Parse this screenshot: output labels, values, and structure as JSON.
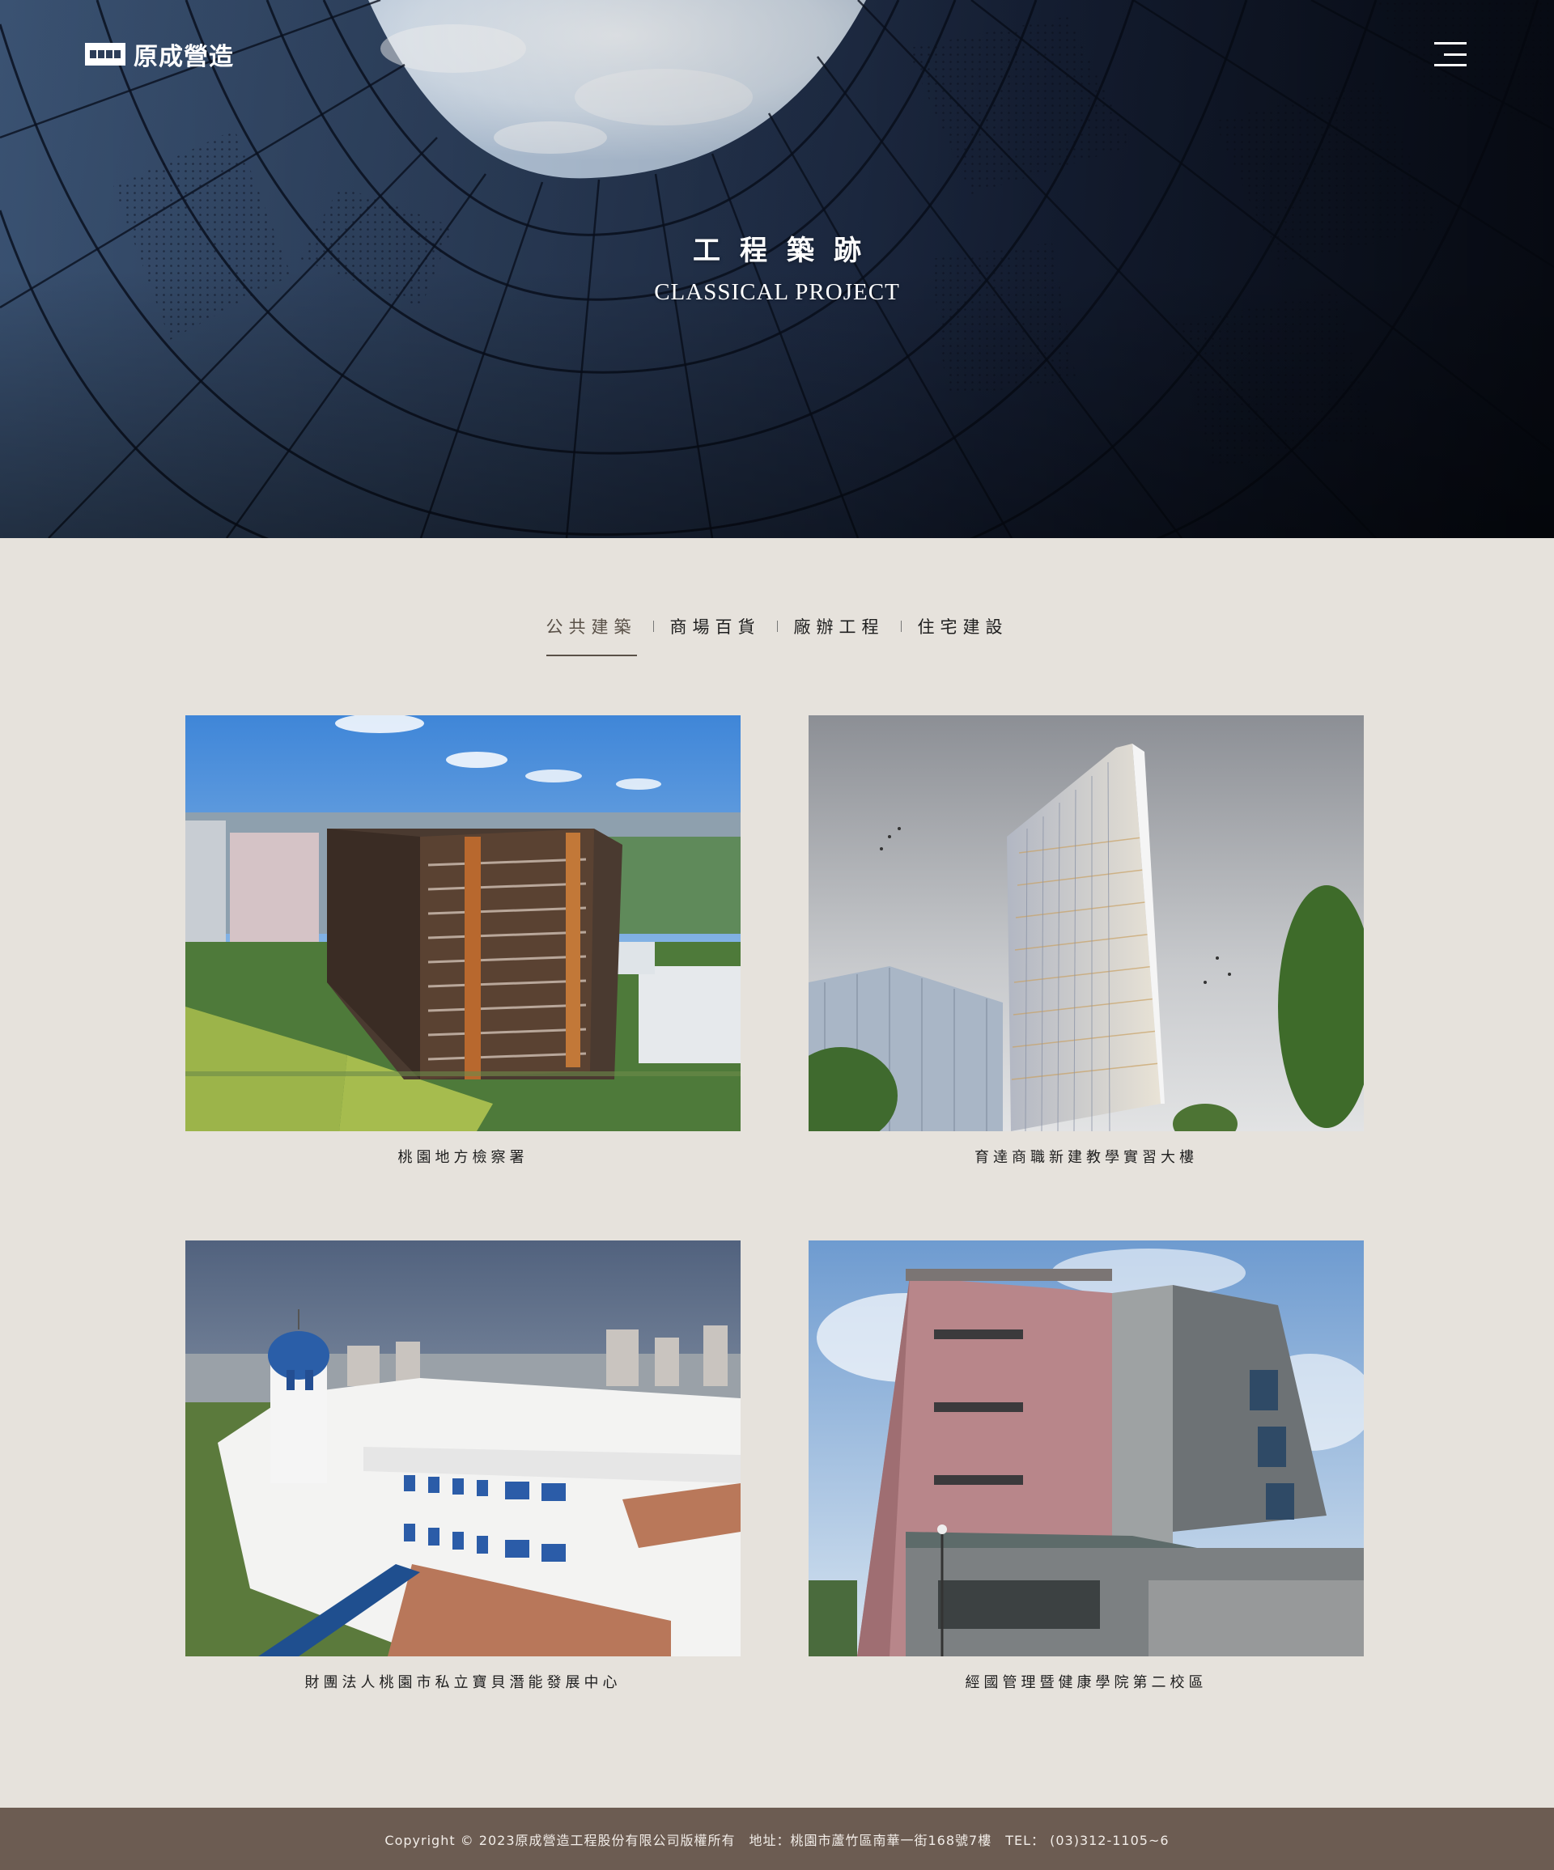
{
  "brand": {
    "logo_text": "原成營造"
  },
  "header": {
    "menu_icon": "hamburger-menu-icon"
  },
  "hero": {
    "title": "工程築跡",
    "subtitle": "CLASSICAL PROJECT"
  },
  "tabs": [
    {
      "label": "公共建築",
      "active": true
    },
    {
      "label": "商場百貨",
      "active": false
    },
    {
      "label": "廠辦工程",
      "active": false
    },
    {
      "label": "住宅建設",
      "active": false
    }
  ],
  "projects": [
    {
      "caption": "桃園地方檢察署"
    },
    {
      "caption": "育達商職新建教學實習大樓"
    },
    {
      "caption": "財團法人桃園市私立寶貝潛能發展中心"
    },
    {
      "caption": "經國管理暨健康學院第二校區"
    }
  ],
  "footer": {
    "text": "Copyright © 2023原成營造工程股份有限公司版權所有　地址：桃園市蘆竹區南華一街168號7樓　TEL： (03)312-1105~6"
  }
}
